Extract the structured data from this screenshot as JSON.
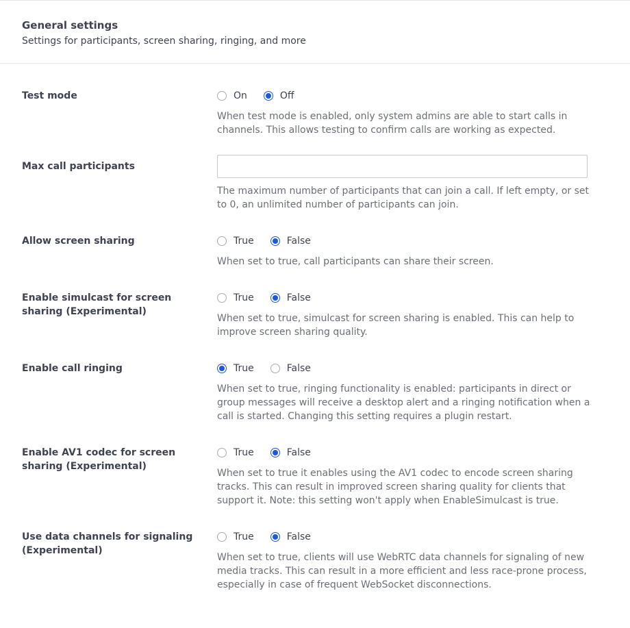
{
  "header": {
    "title": "General settings",
    "subtitle": "Settings for participants, screen sharing, ringing, and more"
  },
  "colors": {
    "accent": "#1c58d9",
    "text": "#3f4350",
    "help_text": "#6b6e76",
    "divider": "#e6e7ea"
  },
  "settings": [
    {
      "label": "Test mode",
      "type": "radio",
      "options": [
        "On",
        "Off"
      ],
      "selected": "Off",
      "help": "When test mode is enabled, only system admins are able to start calls in channels. This allows testing to confirm calls are working as expected."
    },
    {
      "label": "Max call participants",
      "type": "text",
      "value": "",
      "placeholder": "",
      "help": "The maximum number of participants that can join a call. If left empty, or set to 0, an unlimited number of participants can join."
    },
    {
      "label": "Allow screen sharing",
      "type": "radio",
      "options": [
        "True",
        "False"
      ],
      "selected": "False",
      "help": "When set to true, call participants can share their screen."
    },
    {
      "label": "Enable simulcast for screen sharing (Experimental)",
      "type": "radio",
      "options": [
        "True",
        "False"
      ],
      "selected": "False",
      "help": "When set to true, simulcast for screen sharing is enabled. This can help to improve screen sharing quality."
    },
    {
      "label": "Enable call ringing",
      "type": "radio",
      "options": [
        "True",
        "False"
      ],
      "selected": "True",
      "help": "When set to true, ringing functionality is enabled: participants in direct or group messages will receive a desktop alert and a ringing notification when a call is started. Changing this setting requires a plugin restart."
    },
    {
      "label": "Enable AV1 codec for screen sharing (Experimental)",
      "type": "radio",
      "options": [
        "True",
        "False"
      ],
      "selected": "False",
      "help": "When set to true it enables using the AV1 codec to encode screen sharing tracks. This can result in improved screen sharing quality for clients that support it. Note: this setting won't apply when EnableSimulcast is true."
    },
    {
      "label": "Use data channels for signaling (Experimental)",
      "type": "radio",
      "options": [
        "True",
        "False"
      ],
      "selected": "False",
      "help": "When set to true, clients will use WebRTC data channels for signaling of new media tracks. This can result in a more efficient and less race-prone process, especially in case of frequent WebSocket disconnections."
    }
  ]
}
